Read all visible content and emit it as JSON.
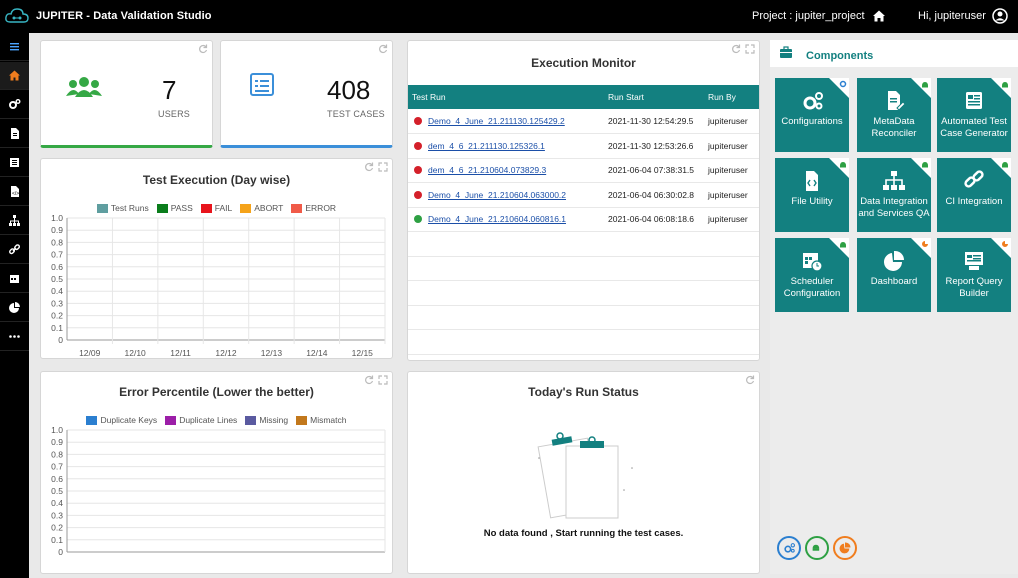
{
  "app": {
    "title": "JUPITER - Data Validation Studio",
    "project_label": "Project :  jupiter_project",
    "greeting": "Hi,  jupiteruser"
  },
  "sidebar": {
    "items": [
      "menu-icon",
      "home-icon",
      "gears-icon",
      "file-icon",
      "report-icon",
      "code-file-icon",
      "sitemap-icon",
      "link-icon",
      "calendar-icon",
      "pie-chart-icon",
      "more-icon"
    ]
  },
  "stats": [
    {
      "value": "7",
      "label": "USERS"
    },
    {
      "value": "408",
      "label": "TEST CASES"
    }
  ],
  "test_execution": {
    "title": "Test Execution (Day wise)",
    "legend": [
      {
        "label": "Test Runs",
        "color": "#5f9ea0"
      },
      {
        "label": "PASS",
        "color": "#0a7d1b"
      },
      {
        "label": "FAIL",
        "color": "#e8141c"
      },
      {
        "label": "ABORT",
        "color": "#f5a31a"
      },
      {
        "label": "ERROR",
        "color": "#f05a48"
      }
    ]
  },
  "error_percentile": {
    "title": "Error Percentile (Lower the better)",
    "legend": [
      {
        "label": "Duplicate Keys",
        "color": "#2b7fd0"
      },
      {
        "label": "Duplicate Lines",
        "color": "#9c1ea8"
      },
      {
        "label": "Missing",
        "color": "#5a5aa0"
      },
      {
        "label": "Mismatch",
        "color": "#c2781c"
      }
    ]
  },
  "chart_data": [
    {
      "type": "bar",
      "title": "Test Execution (Day wise)",
      "categories": [
        "12/09",
        "12/10",
        "12/11",
        "12/12",
        "12/13",
        "12/14",
        "12/15"
      ],
      "series": [
        {
          "name": "Test Runs",
          "values": []
        },
        {
          "name": "PASS",
          "values": []
        },
        {
          "name": "FAIL",
          "values": []
        },
        {
          "name": "ABORT",
          "values": []
        },
        {
          "name": "ERROR",
          "values": []
        }
      ],
      "yticks": [
        "1.0",
        "0.9",
        "0.8",
        "0.7",
        "0.6",
        "0.5",
        "0.4",
        "0.3",
        "0.2",
        "0.1",
        "0"
      ],
      "ylim": [
        0,
        1
      ]
    },
    {
      "type": "bar",
      "title": "Error Percentile (Lower the better)",
      "categories": [],
      "series": [
        {
          "name": "Duplicate Keys",
          "values": []
        },
        {
          "name": "Duplicate Lines",
          "values": []
        },
        {
          "name": "Missing",
          "values": []
        },
        {
          "name": "Mismatch",
          "values": []
        }
      ],
      "yticks": [
        "1.0",
        "0.9",
        "0.8",
        "0.7",
        "0.6",
        "0.5",
        "0.4",
        "0.3",
        "0.2",
        "0.1",
        "0"
      ],
      "ylim": [
        0,
        1
      ]
    }
  ],
  "execution_monitor": {
    "title": "Execution Monitor",
    "columns": [
      "Test Run",
      "Run Start",
      "Run By"
    ],
    "rows": [
      {
        "status": "red",
        "run": "Demo_4_June_21.211130.125429.2",
        "start": "2021-11-30 12:54:29.5",
        "by": "jupiteruser"
      },
      {
        "status": "red",
        "run": "dem_4_6_21.211130.125326.1",
        "start": "2021-11-30 12:53:26.6",
        "by": "jupiteruser"
      },
      {
        "status": "red",
        "run": "dem_4_6_21.210604.073829.3",
        "start": "2021-06-04 07:38:31.5",
        "by": "jupiteruser"
      },
      {
        "status": "red",
        "run": "Demo_4_June_21.210604.063000.2",
        "start": "2021-06-04 06:30:02.8",
        "by": "jupiteruser"
      },
      {
        "status": "green",
        "run": "Demo_4_June_21.210604.060816.1",
        "start": "2021-06-04 06:08:18.6",
        "by": "jupiteruser"
      }
    ]
  },
  "run_status": {
    "title": "Today's Run Status",
    "empty_text": "No data found , Start running the test cases."
  },
  "components": {
    "title": "Components",
    "tiles": [
      {
        "label": "Configurations",
        "icon": "gears-icon",
        "badge": "gears"
      },
      {
        "label": "MetaData Reconciler",
        "icon": "file-edit-icon",
        "badge": "android"
      },
      {
        "label": "Automated Test Case Generator",
        "icon": "report-icon",
        "badge": "android"
      },
      {
        "label": "File Utility",
        "icon": "code-file-icon",
        "badge": "android"
      },
      {
        "label": "Data Integration and Services QA",
        "icon": "sitemap-icon",
        "badge": "android"
      },
      {
        "label": "CI Integration",
        "icon": "link-icon",
        "badge": "android"
      },
      {
        "label": "Scheduler Configuration",
        "icon": "calendar-clock-icon",
        "badge": "android"
      },
      {
        "label": "Dashboard",
        "icon": "pie-chart-icon",
        "badge": "pie"
      },
      {
        "label": "Report Query Builder",
        "icon": "report-query-icon",
        "badge": "pie"
      }
    ],
    "filters": [
      {
        "icon": "gears-icon",
        "color": "#2b7fd0"
      },
      {
        "icon": "android-icon",
        "color": "#2ea043"
      },
      {
        "icon": "pie-chart-icon",
        "color": "#f07d1e"
      }
    ]
  }
}
